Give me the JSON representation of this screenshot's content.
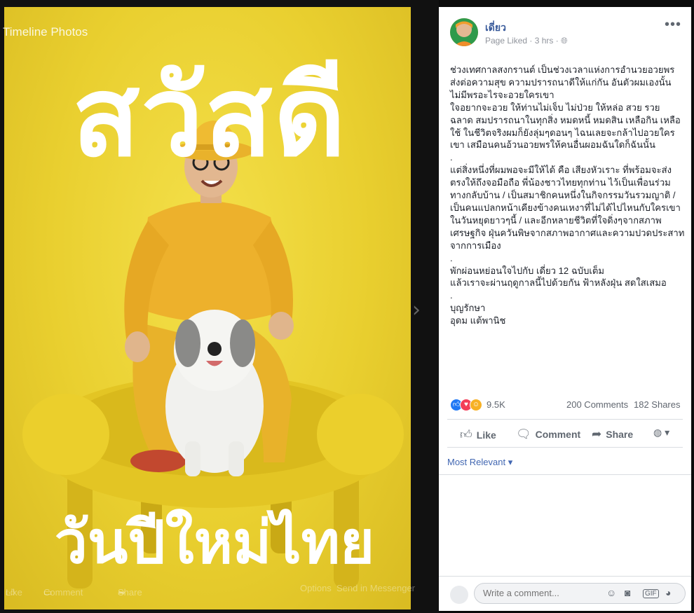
{
  "photo_viewer": {
    "timeline_label": "Timeline Photos",
    "image_text_top": "สวัสดี",
    "image_text_bottom": "วันปีใหม่ไทย",
    "actions": [
      "Like",
      "Comment",
      "Share"
    ],
    "extra_actions": [
      "Options",
      "Send in Messenger"
    ]
  },
  "post": {
    "author": "เดี่ยว",
    "status": "Page Liked",
    "time": "3 hrs",
    "body": "ช่วงเทศกาลสงกรานต์ เป็นช่วงเวลาแห่งการอำนวยอวยพร ส่งต่อความสุข ความปรารถนาดีให้แก่กัน อันตัวผมเองนั้นไม่มีพรอะไรจะอวยใครเขา\nใจอยากจะอวย ให้ท่านไม่เจ็บ ไม่ป่วย ให้หล่อ สวย รวย ฉลาด สมปรารถนาในทุกสิ่ง หมดหนี้ หมดสิน เหลือกิน เหลือใช้ ในชีวิตจริงผมก็ยังลุ่มๆดอนๆ ไฉนเลยจะกล้าไปอวยใครเขา เสมือนคนอ้วนอวยพรให้คนอื่นผอมฉันใดก็ฉันนั้น\n.\nแต่สิ่งหนึ่งที่ผมพอจะมีให้ได้ คือ เสียงหัวเราะ ที่พร้อมจะส่งตรงให้ถึงจอมือถือ พี่น้องชาวไทยทุกท่าน ไว้เป็นเพื่อนร่วมทางกลับบ้าน / เป็นสมาชิกคนหนึ่งในกิจกรรมวันรวมญาติ / เป็นคนแปลกหน้าเคียงข้างคนเหงาที่ไม่ได้ไปไหนกับใครเขาในวันหยุดยาวๆนี้ / และอีกหลายชีวิตที่ใจดิ่งๆจากสภาพเศรษฐกิจ ฝุ่นควันพิษจากสภาพอากาศและความปวดประสาทจากการเมือง\n.\nพักผ่อนหย่อนใจไปกับ เดี่ยว 12 ฉบับเต็ม\nแล้วเราจะผ่านฤดูกาลนี้ไปด้วยกัน ฟ้าหลังฝุ่น สดใสเสมอ\n.\nบุญรักษา\nอุดม แต้พานิช",
    "reactions_count": "9.5K",
    "comments_count": "200 Comments",
    "shares_count": "182 Shares",
    "like_label": "Like",
    "comment_label": "Comment",
    "share_label": "Share",
    "sort_label": "Most Relevant",
    "comment_placeholder": "Write a comment..."
  },
  "colors": {
    "brand_blue": "#365899",
    "photo_yellow": "#e9cf2f",
    "like_blue": "#2078f4",
    "love_red": "#f33e58",
    "haha_yellow": "#f7b125"
  }
}
